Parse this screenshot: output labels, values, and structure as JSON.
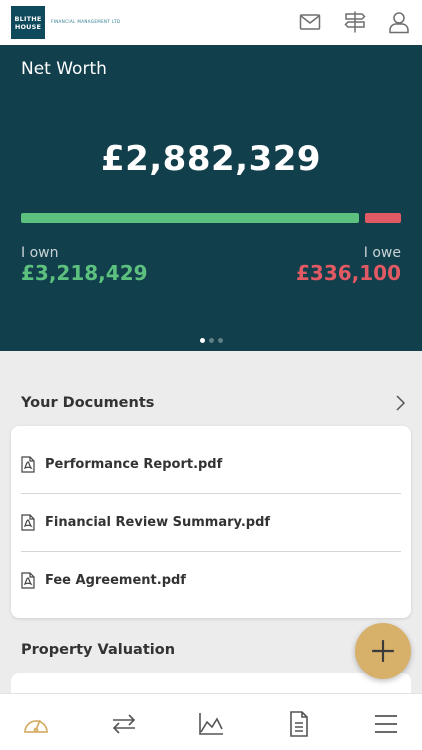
{
  "header": {
    "logo_line1": "BLITHE",
    "logo_line2": "HOUSE",
    "logo_sub": "FINANCIAL MANAGEMENT LTD"
  },
  "net_worth": {
    "title": "Net Worth",
    "total": "£2,882,329",
    "own_label": "I own",
    "own_value": "£3,218,429",
    "owe_label": "I owe",
    "owe_value": "£336,100",
    "own_fraction": 0.905,
    "owe_fraction": 0.095,
    "carousel_pages": 3,
    "carousel_active": 1
  },
  "documents": {
    "title": "Your Documents",
    "items": [
      {
        "name": "Performance Report.pdf"
      },
      {
        "name": "Financial Review Summary.pdf"
      },
      {
        "name": "Fee Agreement.pdf"
      }
    ]
  },
  "property": {
    "title": "Property Valuation"
  },
  "colors": {
    "primary": "#123f4c",
    "own": "#5cc07e",
    "owe": "#e15a63",
    "accent": "#d7b06a"
  },
  "icons": {
    "mail": "mail-icon",
    "signpost": "signpost-icon",
    "user": "user-icon",
    "chevron": "chevron-right-icon",
    "pdf": "pdf-icon",
    "fab": "plus-icon",
    "nav": [
      "dashboard-gauge-icon",
      "transfer-arrows-icon",
      "chart-icon",
      "document-icon",
      "menu-icon"
    ]
  }
}
